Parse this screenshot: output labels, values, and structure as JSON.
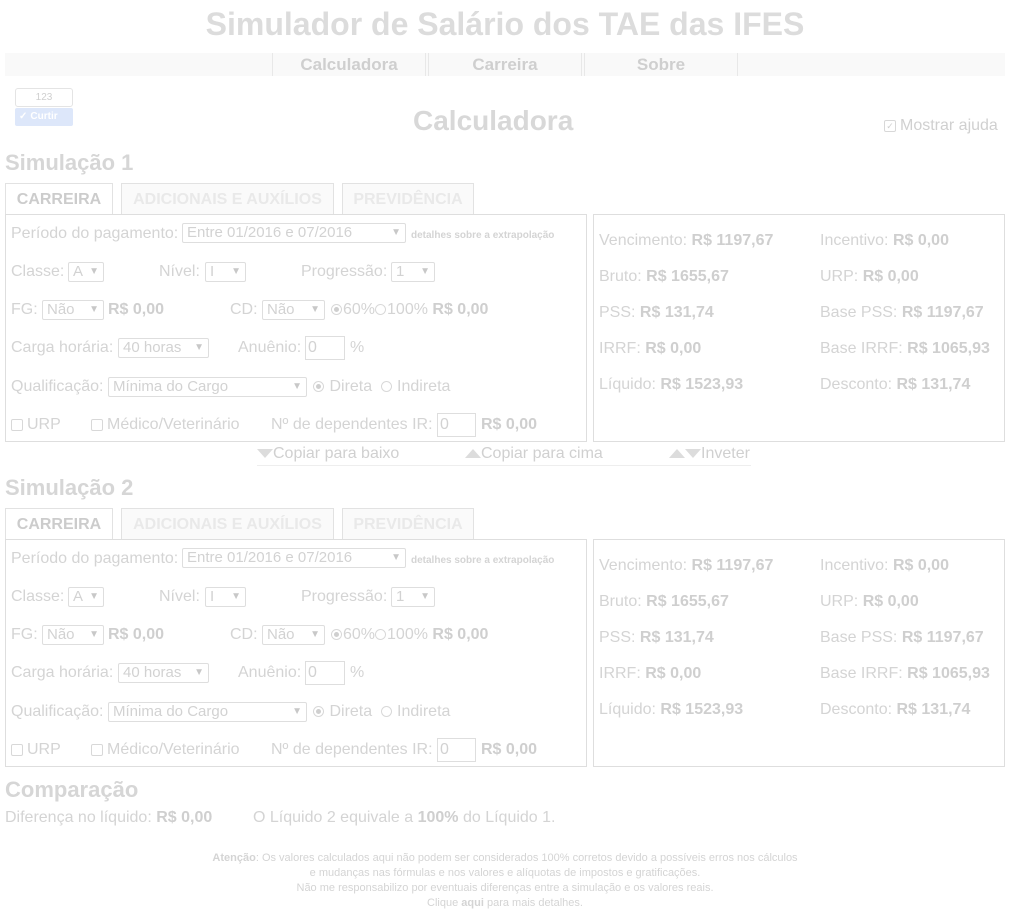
{
  "app_title": "Simulador de Salário dos TAE das IFES",
  "nav": {
    "items": [
      "Calculadora",
      "Carreira",
      "Sobre"
    ]
  },
  "like": {
    "count": "123",
    "label": "Curtir"
  },
  "page_title": "Calculadora",
  "help_toggle": {
    "label": "Mostrar ajuda",
    "checked": true
  },
  "simulations": [
    {
      "title": "Simulação 1",
      "tabs": [
        "CARREIRA",
        "ADICIONAIS E AUXÍLIOS",
        "PREVIDÊNCIA"
      ],
      "form": {
        "periodo_label": "Período do pagamento:",
        "periodo_value": "Entre 01/2016 e 07/2016",
        "periodo_link": "detalhes sobre a extrapolação",
        "classe_label": "Classe:",
        "classe_value": "A",
        "nivel_label": "Nível:",
        "nivel_value": "I",
        "progressao_label": "Progressão:",
        "progressao_value": "1",
        "fg_label": "FG:",
        "fg_value": "Não",
        "fg_amount": "R$ 0,00",
        "cd_label": "CD:",
        "cd_value": "Não",
        "cd_opt1": "60%",
        "cd_opt2": "100%",
        "cd_amount": "R$ 0,00",
        "carga_label": "Carga horária:",
        "carga_value": "40 horas",
        "anuenio_label": "Anuênio:",
        "anuenio_value": "0",
        "anuenio_unit": "%",
        "qualif_label": "Qualificação:",
        "qualif_value": "Mínima do Cargo",
        "qualif_opt1": "Direta",
        "qualif_opt2": "Indireta",
        "urp_label": "URP",
        "medico_label": "Médico/Veterinário",
        "dep_label": "Nº de dependentes IR:",
        "dep_value": "0",
        "dep_amount": "R$ 0,00"
      },
      "results": {
        "vencimento_label": "Vencimento:",
        "vencimento": "R$ 1197,67",
        "incentivo_label": "Incentivo:",
        "incentivo": "R$ 0,00",
        "bruto_label": "Bruto:",
        "bruto": "R$ 1655,67",
        "urp_label": "URP:",
        "urp": "R$ 0,00",
        "pss_label": "PSS:",
        "pss": "R$ 131,74",
        "base_pss_label": "Base PSS:",
        "base_pss": "R$ 1197,67",
        "irrf_label": "IRRF:",
        "irrf": "R$ 0,00",
        "base_irrf_label": "Base IRRF:",
        "base_irrf": "R$ 1065,93",
        "liquido_label": "Líquido:",
        "liquido": "R$ 1523,93",
        "desconto_label": "Desconto:",
        "desconto": "R$ 131,74"
      }
    },
    {
      "title": "Simulação 2",
      "tabs": [
        "CARREIRA",
        "ADICIONAIS E AUXÍLIOS",
        "PREVIDÊNCIA"
      ],
      "form": {
        "periodo_label": "Período do pagamento:",
        "periodo_value": "Entre 01/2016 e 07/2016",
        "periodo_link": "detalhes sobre a extrapolação",
        "classe_label": "Classe:",
        "classe_value": "A",
        "nivel_label": "Nível:",
        "nivel_value": "I",
        "progressao_label": "Progressão:",
        "progressao_value": "1",
        "fg_label": "FG:",
        "fg_value": "Não",
        "fg_amount": "R$ 0,00",
        "cd_label": "CD:",
        "cd_value": "Não",
        "cd_opt1": "60%",
        "cd_opt2": "100%",
        "cd_amount": "R$ 0,00",
        "carga_label": "Carga horária:",
        "carga_value": "40 horas",
        "anuenio_label": "Anuênio:",
        "anuenio_value": "0",
        "anuenio_unit": "%",
        "qualif_label": "Qualificação:",
        "qualif_value": "Mínima do Cargo",
        "qualif_opt1": "Direta",
        "qualif_opt2": "Indireta",
        "urp_label": "URP",
        "medico_label": "Médico/Veterinário",
        "dep_label": "Nº de dependentes IR:",
        "dep_value": "0",
        "dep_amount": "R$ 0,00"
      },
      "results": {
        "vencimento_label": "Vencimento:",
        "vencimento": "R$ 1197,67",
        "incentivo_label": "Incentivo:",
        "incentivo": "R$ 0,00",
        "bruto_label": "Bruto:",
        "bruto": "R$ 1655,67",
        "urp_label": "URP:",
        "urp": "R$ 0,00",
        "pss_label": "PSS:",
        "pss": "R$ 131,74",
        "base_pss_label": "Base PSS:",
        "base_pss": "R$ 1197,67",
        "irrf_label": "IRRF:",
        "irrf": "R$ 0,00",
        "base_irrf_label": "Base IRRF:",
        "base_irrf": "R$ 1065,93",
        "liquido_label": "Líquido:",
        "liquido": "R$ 1523,93",
        "desconto_label": "Desconto:",
        "desconto": "R$ 131,74"
      }
    }
  ],
  "copy_bar": {
    "copy_down": "Copiar para baixo",
    "copy_up": "Copiar para cima",
    "invert": "Inveter"
  },
  "comparison": {
    "title": "Comparação",
    "diff_label": "Diferença no líquido:",
    "diff_value": "R$ 0,00",
    "equiv_prefix": "O Líquido 2 equivale a",
    "equiv_value": "100%",
    "equiv_suffix": "do Líquido 1."
  },
  "footer": {
    "attention_label": "Atenção",
    "line1": ": Os valores calculados aqui não podem ser considerados 100% corretos devido a possíveis erros nos cálculos",
    "line2": "e mudanças nas fórmulas e nos valores e alíquotas de impostos e gratificações.",
    "line3": "Não me responsabilizo por eventuais diferenças entre a simulação e os valores reais.",
    "line4_prefix": "Clique",
    "line4_link": "aqui",
    "line4_suffix": "para mais detalhes."
  }
}
